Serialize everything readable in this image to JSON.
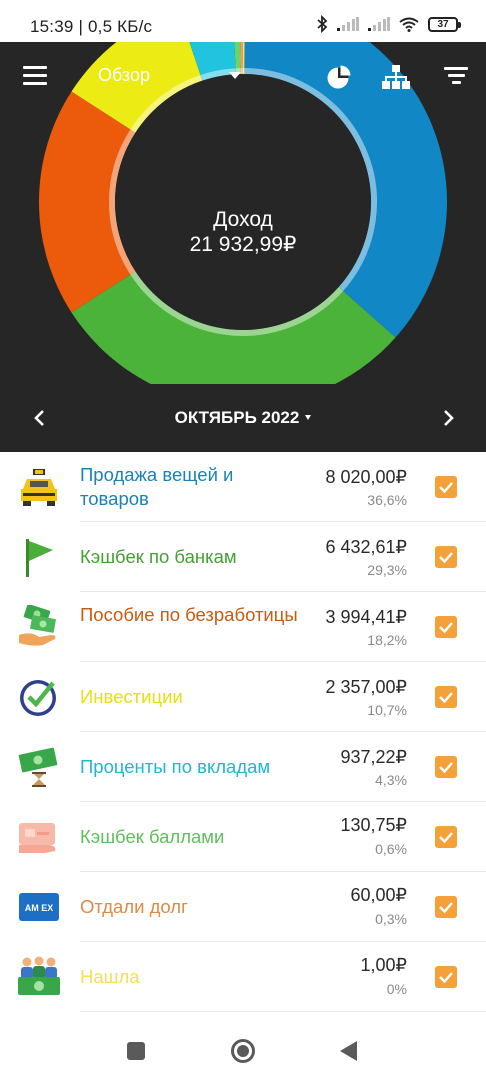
{
  "status_bar": {
    "time_speed": "15:39 | 0,5 КБ/с",
    "battery": "37"
  },
  "toolbar": {
    "view_label": "Обзор"
  },
  "chart_data": {
    "type": "pie",
    "title": "Доход",
    "total": "21 932,99₽",
    "categories": [
      "Продажа вещей и товаров",
      "Кэшбек по банкам",
      "Пособие по безработицы",
      "Инвестиции",
      "Проценты по вкладам",
      "Кэшбек баллами",
      "Отдали долг",
      "Нашла"
    ],
    "values": [
      8020.0,
      6432.61,
      3994.41,
      2357.0,
      937.22,
      130.75,
      60.0,
      1.0
    ],
    "colors": [
      "#1187c6",
      "#4cb33a",
      "#ec5a0c",
      "#ecec14",
      "#22c3df",
      "#6bd367",
      "#f0a060",
      "#f4e25e"
    ]
  },
  "month": {
    "label": "ОКТЯБРЬ 2022"
  },
  "items": [
    {
      "name": "Продажа вещей и товаров",
      "amount": "8 020,00₽",
      "percent": "36,6%",
      "color": "#1b82b8",
      "icon": "taxi-icon",
      "checked": true
    },
    {
      "name": "Кэшбек по банкам",
      "amount": "6 432,61₽",
      "percent": "29,3%",
      "color": "#45a034",
      "icon": "flag-icon",
      "checked": true
    },
    {
      "name": "Пособие по безработицы",
      "amount": "3 994,41₽",
      "percent": "18,2%",
      "color": "#c95b12",
      "icon": "money-hand-icon",
      "checked": true
    },
    {
      "name": "Инвестиции",
      "amount": "2 357,00₽",
      "percent": "10,7%",
      "color": "#e6df12",
      "icon": "clock-check-icon",
      "checked": true
    },
    {
      "name": "Проценты по вкладам",
      "amount": "937,22₽",
      "percent": "4,3%",
      "color": "#22b6cf",
      "icon": "money-hourglass-icon",
      "checked": true
    },
    {
      "name": "Кэшбек баллами",
      "amount": "130,75₽",
      "percent": "0,6%",
      "color": "#5fbf5b",
      "icon": "card-hand-icon",
      "checked": true
    },
    {
      "name": "Отдали долг",
      "amount": "60,00₽",
      "percent": "0,3%",
      "color": "#e08a45",
      "icon": "amex-card-icon",
      "checked": true
    },
    {
      "name": "Нашла",
      "amount": "1,00₽",
      "percent": "0%",
      "color": "#f2e055",
      "icon": "group-money-icon",
      "checked": true
    }
  ],
  "icon_labels": {
    "amex": "AM EX"
  }
}
